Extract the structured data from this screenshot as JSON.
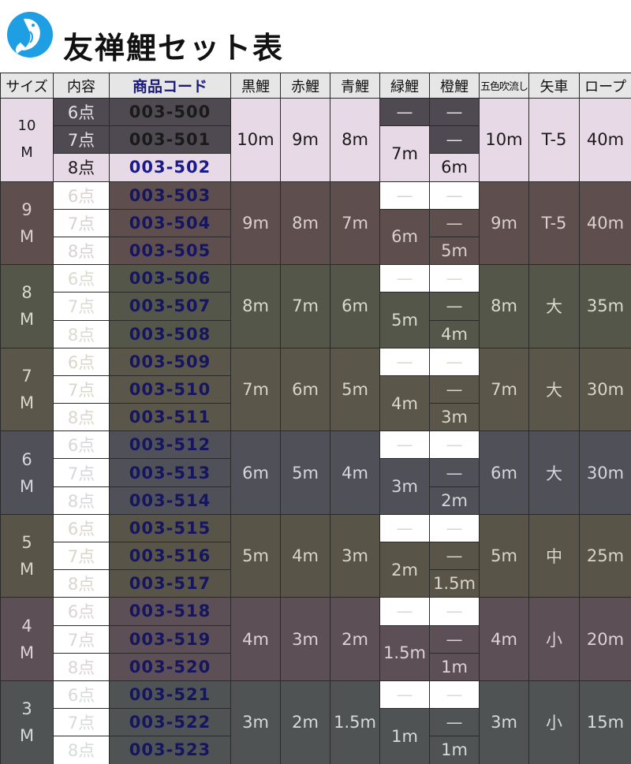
{
  "title": "友禅鯉セット表",
  "icons": {
    "logo": "koi-logo-icon"
  },
  "colors": {
    "code_text": "#151560",
    "logo_blue": "#1e9fe3"
  },
  "headers": [
    "サイズ",
    "内容",
    "商品コード",
    "黒鯉",
    "赤鯉",
    "青鯉",
    "緑鯉",
    "橙鯉",
    "五色吹流し",
    "矢車",
    "ロープ"
  ],
  "groups": [
    {
      "size_num": "10",
      "size_unit": "M",
      "points": [
        "6点",
        "7点",
        "8点"
      ],
      "codes": [
        "003-500",
        "003-501",
        "003-502"
      ],
      "black": "10m",
      "red": "9m",
      "blue": "8m",
      "green_dash": "—",
      "green": "7m",
      "orange_dash1": "—",
      "orange_dash2": "—",
      "orange": "6m",
      "goshiki": "10m",
      "yaguruma": "T-5",
      "rope": "40m"
    },
    {
      "size_num": "9",
      "size_unit": "M",
      "points": [
        "6点",
        "7点",
        "8点"
      ],
      "codes": [
        "003-503",
        "003-504",
        "003-505"
      ],
      "black": "9m",
      "red": "8m",
      "blue": "7m",
      "green_dash": "—",
      "green": "6m",
      "orange_dash1": "—",
      "orange_dash2": "—",
      "orange": "5m",
      "goshiki": "9m",
      "yaguruma": "T-5",
      "rope": "40m"
    },
    {
      "size_num": "8",
      "size_unit": "M",
      "points": [
        "6点",
        "7点",
        "8点"
      ],
      "codes": [
        "003-506",
        "003-507",
        "003-508"
      ],
      "black": "8m",
      "red": "7m",
      "blue": "6m",
      "green_dash": "—",
      "green": "5m",
      "orange_dash1": "—",
      "orange_dash2": "—",
      "orange": "4m",
      "goshiki": "8m",
      "yaguruma": "大",
      "rope": "35m"
    },
    {
      "size_num": "7",
      "size_unit": "M",
      "points": [
        "6点",
        "7点",
        "8点"
      ],
      "codes": [
        "003-509",
        "003-510",
        "003-511"
      ],
      "black": "7m",
      "red": "6m",
      "blue": "5m",
      "green_dash": "—",
      "green": "4m",
      "orange_dash1": "—",
      "orange_dash2": "—",
      "orange": "3m",
      "goshiki": "7m",
      "yaguruma": "大",
      "rope": "30m"
    },
    {
      "size_num": "6",
      "size_unit": "M",
      "points": [
        "6点",
        "7点",
        "8点"
      ],
      "codes": [
        "003-512",
        "003-513",
        "003-514"
      ],
      "black": "6m",
      "red": "5m",
      "blue": "4m",
      "green_dash": "—",
      "green": "3m",
      "orange_dash1": "—",
      "orange_dash2": "—",
      "orange": "2m",
      "goshiki": "6m",
      "yaguruma": "大",
      "rope": "30m"
    },
    {
      "size_num": "5",
      "size_unit": "M",
      "points": [
        "6点",
        "7点",
        "8点"
      ],
      "codes": [
        "003-515",
        "003-516",
        "003-517"
      ],
      "black": "5m",
      "red": "4m",
      "blue": "3m",
      "green_dash": "—",
      "green": "2m",
      "orange_dash1": "—",
      "orange_dash2": "—",
      "orange": "1.5m",
      "goshiki": "5m",
      "yaguruma": "中",
      "rope": "25m"
    },
    {
      "size_num": "4",
      "size_unit": "M",
      "points": [
        "6点",
        "7点",
        "8点"
      ],
      "codes": [
        "003-518",
        "003-519",
        "003-520"
      ],
      "black": "4m",
      "red": "3m",
      "blue": "2m",
      "green_dash": "—",
      "green": "1.5m",
      "orange_dash1": "—",
      "orange_dash2": "—",
      "orange": "1m",
      "goshiki": "4m",
      "yaguruma": "小",
      "rope": "20m"
    },
    {
      "size_num": "3",
      "size_unit": "M",
      "points": [
        "6点",
        "7点",
        "8点"
      ],
      "codes": [
        "003-521",
        "003-522",
        "003-523"
      ],
      "black": "3m",
      "red": "2m",
      "blue": "1.5m",
      "green_dash": "—",
      "green": "1m",
      "orange_dash1": "—",
      "orange_dash2": "—",
      "orange": "1m",
      "goshiki": "3m",
      "yaguruma": "小",
      "rope": "15m"
    }
  ]
}
